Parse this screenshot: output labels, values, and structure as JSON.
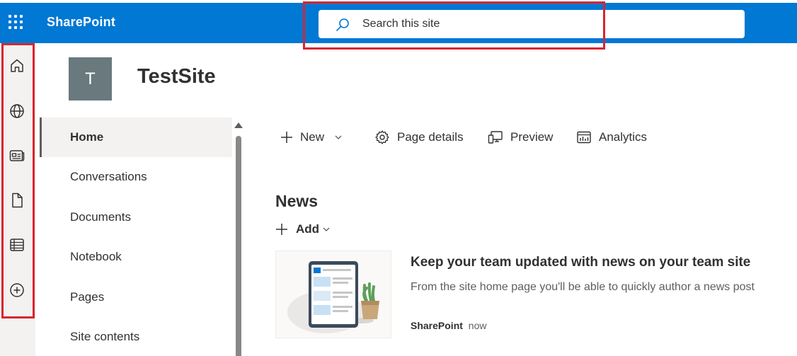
{
  "suitebar": {
    "brand": "SharePoint",
    "search_placeholder": "Search this site",
    "accent": "#0078d4"
  },
  "appbar": {
    "icons": [
      "home-icon",
      "globe-icon",
      "news-icon",
      "file-icon",
      "list-icon",
      "add-circle-icon"
    ]
  },
  "site": {
    "logo_letter": "T",
    "title": "TestSite"
  },
  "leftnav": {
    "items": [
      {
        "label": "Home",
        "active": true
      },
      {
        "label": "Conversations"
      },
      {
        "label": "Documents"
      },
      {
        "label": "Notebook"
      },
      {
        "label": "Pages"
      },
      {
        "label": "Site contents"
      }
    ]
  },
  "commandbar": {
    "new_label": "New",
    "page_details_label": "Page details",
    "preview_label": "Preview",
    "analytics_label": "Analytics"
  },
  "news": {
    "title": "News",
    "add_label": "Add",
    "card": {
      "headline": "Keep your team updated with news on your team site",
      "description": "From the site home page you'll be able to quickly author a news post",
      "author": "SharePoint",
      "time": "now"
    }
  },
  "colors": {
    "highlight": "#d9252e",
    "appbar_bg": "#f3f2f1"
  }
}
